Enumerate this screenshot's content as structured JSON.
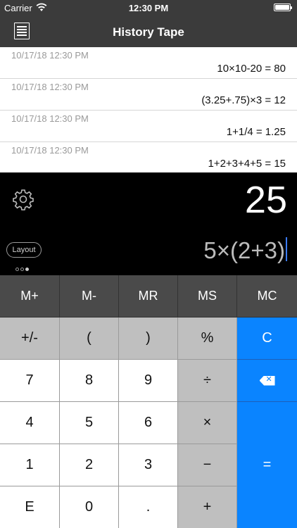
{
  "status_bar": {
    "carrier": "Carrier",
    "time": "12:30 PM"
  },
  "nav": {
    "title": "History Tape",
    "left_icon": "list-document-icon"
  },
  "history": [
    {
      "date": "10/17/18 12:30 PM",
      "expression": "10×10-20 = 80"
    },
    {
      "date": "10/17/18 12:30 PM",
      "expression": "(3.25+.75)×3 = 12"
    },
    {
      "date": "10/17/18 12:30 PM",
      "expression": "1+1/4 = 1.25"
    },
    {
      "date": "10/17/18 12:30 PM",
      "expression": "1+2+3+4+5 = 15"
    }
  ],
  "display": {
    "result": "25",
    "expression": "5×(2+3)",
    "layout_label": "Layout",
    "settings_icon": "gear-icon"
  },
  "keys": {
    "mplus": "M+",
    "mminus": "M-",
    "mr": "MR",
    "ms": "MS",
    "mc": "MC",
    "sign": "+/-",
    "lparen": "(",
    "rparen": ")",
    "percent": "%",
    "clear": "C",
    "seven": "7",
    "eight": "8",
    "nine": "9",
    "divide": "÷",
    "four": "4",
    "five": "5",
    "six": "6",
    "multiply": "×",
    "one": "1",
    "two": "2",
    "three": "3",
    "minus": "−",
    "equals": "=",
    "exp": "E",
    "zero": "0",
    "dot": ".",
    "plus": "+"
  },
  "colors": {
    "accent": "#0a84ff",
    "memory_row": "#4a4a4a",
    "function_key": "#bfbfbf"
  }
}
